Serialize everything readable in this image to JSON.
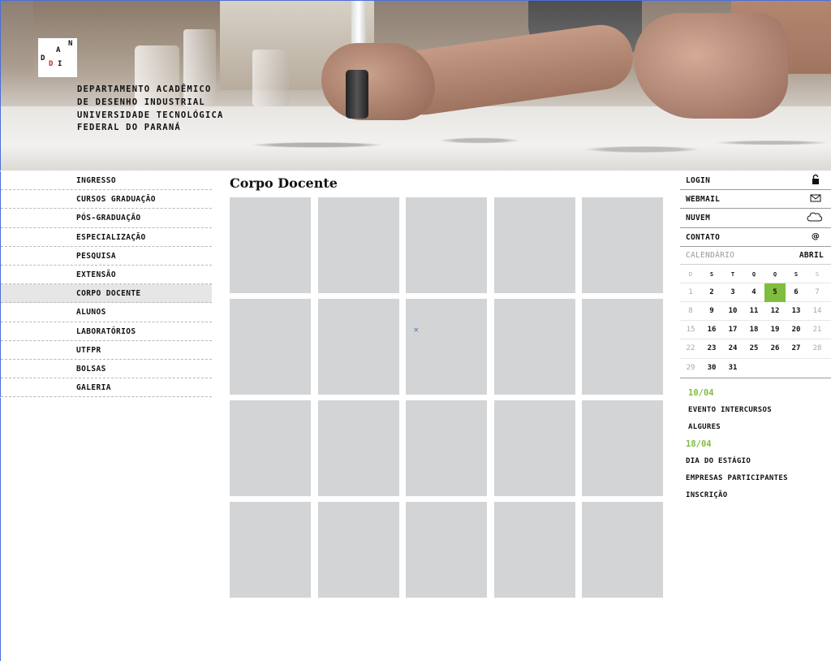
{
  "header": {
    "logo_letters": [
      "D",
      "A",
      "N",
      "D",
      "I"
    ],
    "department_lines": [
      "DEPARTAMENTO ACADÊMICO",
      "DE DESENHO INDUSTRIAL",
      "UNIVERSIDADE TECNOLÓGICA",
      "FEDERAL DO PARANÁ"
    ]
  },
  "nav": {
    "items": [
      "INGRESSO",
      "CURSOS GRADUAÇÃO",
      "PÓS-GRADUAÇÃO",
      "ESPECIALIZAÇÃO",
      "PESQUISA",
      "EXTENSÃO",
      "CORPO DOCENTE",
      "ALUNOS",
      "LABORATÓRIOS",
      "UTFPR",
      "BOLSAS",
      "GALERIA"
    ],
    "active": "CORPO DOCENTE"
  },
  "main": {
    "title": "Corpo Docente",
    "grid_rows": 4,
    "grid_cols": 5,
    "broken_image_glyph": "×"
  },
  "right": {
    "links": [
      {
        "label": "LOGIN",
        "icon": "lock-icon"
      },
      {
        "label": "WEBMAIL",
        "icon": "envelope-icon"
      },
      {
        "label": "NUVEM",
        "icon": "cloud-icon"
      },
      {
        "label": "CONTATO",
        "icon": "at-icon"
      }
    ],
    "at_symbol": "@",
    "calendar": {
      "label": "CALENDÁRIO",
      "month": "ABRIL",
      "weekdays": [
        "D",
        "S",
        "T",
        "Q",
        "Q",
        "S",
        "S"
      ],
      "weeks": [
        [
          "1",
          "2",
          "3",
          "4",
          "5",
          "6",
          "7"
        ],
        [
          "8",
          "9",
          "10",
          "11",
          "12",
          "13",
          "14"
        ],
        [
          "15",
          "16",
          "17",
          "18",
          "19",
          "20",
          "21"
        ],
        [
          "22",
          "23",
          "24",
          "25",
          "26",
          "27",
          "28"
        ],
        [
          "29",
          "30",
          "31",
          "",
          "",
          "",
          ""
        ]
      ],
      "today": "5"
    },
    "events": [
      {
        "date": "10/04",
        "lines": [
          "EVENTO INTERCURSOS",
          "ALGURES"
        ]
      },
      {
        "date": "18/04",
        "lines": [
          "DIA DO ESTÁGIO",
          "EMPRESAS PARTICIPANTES",
          "INSCRIÇÃO"
        ]
      }
    ]
  },
  "colors": {
    "accent_green": "#7fbd3f",
    "tile_gray": "#d3d4d6",
    "logo_red": "#d32020"
  }
}
